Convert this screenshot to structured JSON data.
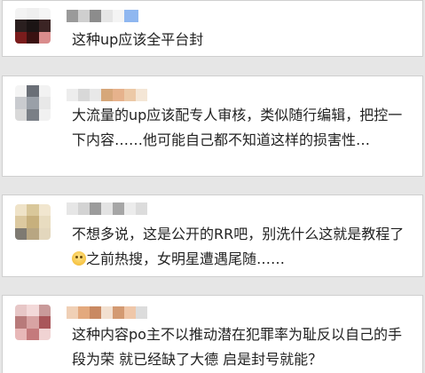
{
  "comments": [
    {
      "text": "这种up应该全平台封"
    },
    {
      "text": "大流量的up应该配专人审核，类似随行编辑，把控一下内容……他可能自己都不知道这样的损害性…"
    },
    {
      "text_before_emoji": "不想多说，这是公开的RR吧，别洗什么这就是教程了",
      "text_after_emoji": "之前热搜，女明星遭遇尾随……"
    },
    {
      "text": "这种内容po主不以推动潜在犯罪率为耻反以自己的手段为荣 就已经缺了大德 启是封号就能？"
    }
  ],
  "colors": {
    "background": "#e6e6e6",
    "card": "#ffffff",
    "text": "#222222",
    "accent_blue": "#8fb7f0"
  },
  "icons": [
    "blurred-avatar",
    "blurred-username",
    "grinning-emoji"
  ]
}
